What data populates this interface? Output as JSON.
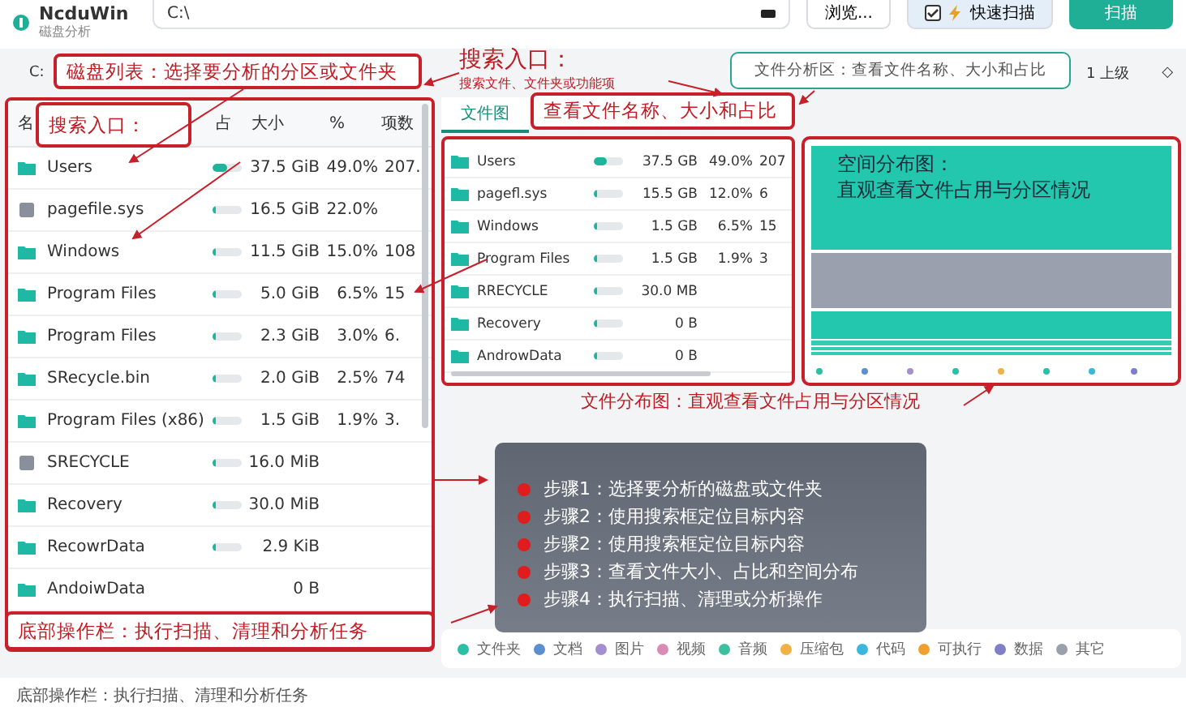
{
  "app": {
    "name": "NcduWin",
    "subtitle": "磁盘分析"
  },
  "path_field": {
    "value": "C:\\"
  },
  "browse_button": "浏览...",
  "quick_scan": {
    "label": "快速扫描",
    "checked": true
  },
  "scan_button": "扫描",
  "toolbar": {
    "drive": "C:",
    "up": "1 上级",
    "toggle": "◇"
  },
  "disk_table": {
    "columns": [
      "名",
      "占",
      "大小",
      "%",
      "项数"
    ],
    "rows": [
      {
        "kind": "folder",
        "name": "Users",
        "level": 0.5,
        "size": "37.5 GiB",
        "percent": "49.0%",
        "count": "207."
      },
      {
        "kind": "file",
        "name": "pagefile.sys",
        "level": 0.1,
        "size": "16.5 GiB",
        "percent": "22.0%"
      },
      {
        "kind": "folder",
        "name": "Windows",
        "level": 0.1,
        "size": "11.5 GiB",
        "percent": "15.0%",
        "count": "108"
      },
      {
        "kind": "folder",
        "name": "Program Files",
        "level": 0.1,
        "size": "5.0 GiB",
        "percent": "6.5%",
        "count": "15"
      },
      {
        "kind": "folder",
        "name": "Program Files",
        "level": 0.1,
        "size": "2.3 GiB",
        "percent": "3.0%",
        "count": "6."
      },
      {
        "kind": "folder",
        "name": "SRecycle.bin",
        "level": 0.1,
        "size": "2.0 GiB",
        "percent": "2.5%",
        "count": "74"
      },
      {
        "kind": "folder",
        "name": "Program Files (x86)",
        "level": 0.1,
        "size": "1.5 GiB",
        "percent": "1.9%",
        "count": "3."
      },
      {
        "kind": "file",
        "name": "SRECYCLE",
        "level": 0.1,
        "size": "16.0 MiB"
      },
      {
        "kind": "folder",
        "name": "Recovery",
        "level": 0.1,
        "size": "30.0 MiB"
      },
      {
        "kind": "folder",
        "name": "RecowrData",
        "level": 0.1,
        "size": "2.9 KiB"
      },
      {
        "kind": "folder",
        "name": "AndoiwData",
        "size": "0 B"
      }
    ]
  },
  "tabs": [
    {
      "label": "文件图",
      "selected": true
    }
  ],
  "file_table": {
    "rows": [
      {
        "kind": "folder",
        "name": "Users",
        "level": 0.45,
        "size": "37.5 GB",
        "percent": "49.0%",
        "count": "207"
      },
      {
        "kind": "folder",
        "name": "pagefl.sys",
        "level": 0.1,
        "size": "15.5 GB",
        "percent": "12.0%",
        "count": "6"
      },
      {
        "kind": "folder",
        "name": "Windows",
        "level": 0.1,
        "size": "1.5 GB",
        "percent": "6.5%",
        "count": "15"
      },
      {
        "kind": "folder",
        "name": "Program Files",
        "level": 0.1,
        "size": "1.5 GB",
        "percent": "1.9%",
        "count": "3"
      },
      {
        "kind": "folder",
        "name": "RRECYCLE",
        "level": 0.1,
        "size": "30.0 MB"
      },
      {
        "kind": "folder",
        "name": "Recovery",
        "level": 0.1,
        "size": "0 B"
      },
      {
        "kind": "folder",
        "name": "AndrowData",
        "level": 0.1,
        "size": "0 B"
      }
    ]
  },
  "callouts": [
    {
      "kind": "boxed",
      "text": "磁盘列表：选择要分析的分区或文件夹"
    },
    {
      "kind": "titled",
      "text": "搜索入口：",
      "subtext": "搜索文件、文件夹或功能项"
    },
    {
      "kind": "teal_boxed",
      "text": "文件分析区：查看文件名称、大小和占比"
    },
    {
      "kind": "boxed",
      "text": "搜索入口："
    },
    {
      "kind": "boxed",
      "text": "查看文件名称、大小和占比"
    },
    {
      "kind": "overlay",
      "text": "空间分布图：",
      "subtext": "直观查看文件占用与分区情况"
    },
    {
      "kind": "plain",
      "text": "文件分布图：直观查看文件占用与分区情况"
    },
    {
      "kind": "boxed",
      "text": "底部操作栏：执行扫描、清理和分析任务"
    }
  ],
  "steps": [
    "步骤1：选择要分析的磁盘或文件夹",
    "步骤2：使用搜索框定位目标内容",
    "步骤2：使用搜索框定位目标内容",
    "步骤3：查看文件大小、占比和空间分布",
    "步骤4：执行扫描、清理或分析操作"
  ],
  "legend": [
    {
      "label": "文件夹",
      "color": "#2bbfa4"
    },
    {
      "label": "文档",
      "color": "#5b8fd0"
    },
    {
      "label": "图片",
      "color": "#a38fd0"
    },
    {
      "label": "视频",
      "color": "#d98ab5"
    },
    {
      "label": "音频",
      "color": "#3cc0a0"
    },
    {
      "label": "压缩包",
      "color": "#f2b144"
    },
    {
      "label": "代码",
      "color": "#3bb6dc"
    },
    {
      "label": "可执行",
      "color": "#f0a030"
    },
    {
      "label": "数据",
      "color": "#7f7fc8"
    },
    {
      "label": "其它",
      "color": "#9aa0ac"
    }
  ],
  "status_bar": "底部操作栏：执行扫描、清理和分析任务"
}
